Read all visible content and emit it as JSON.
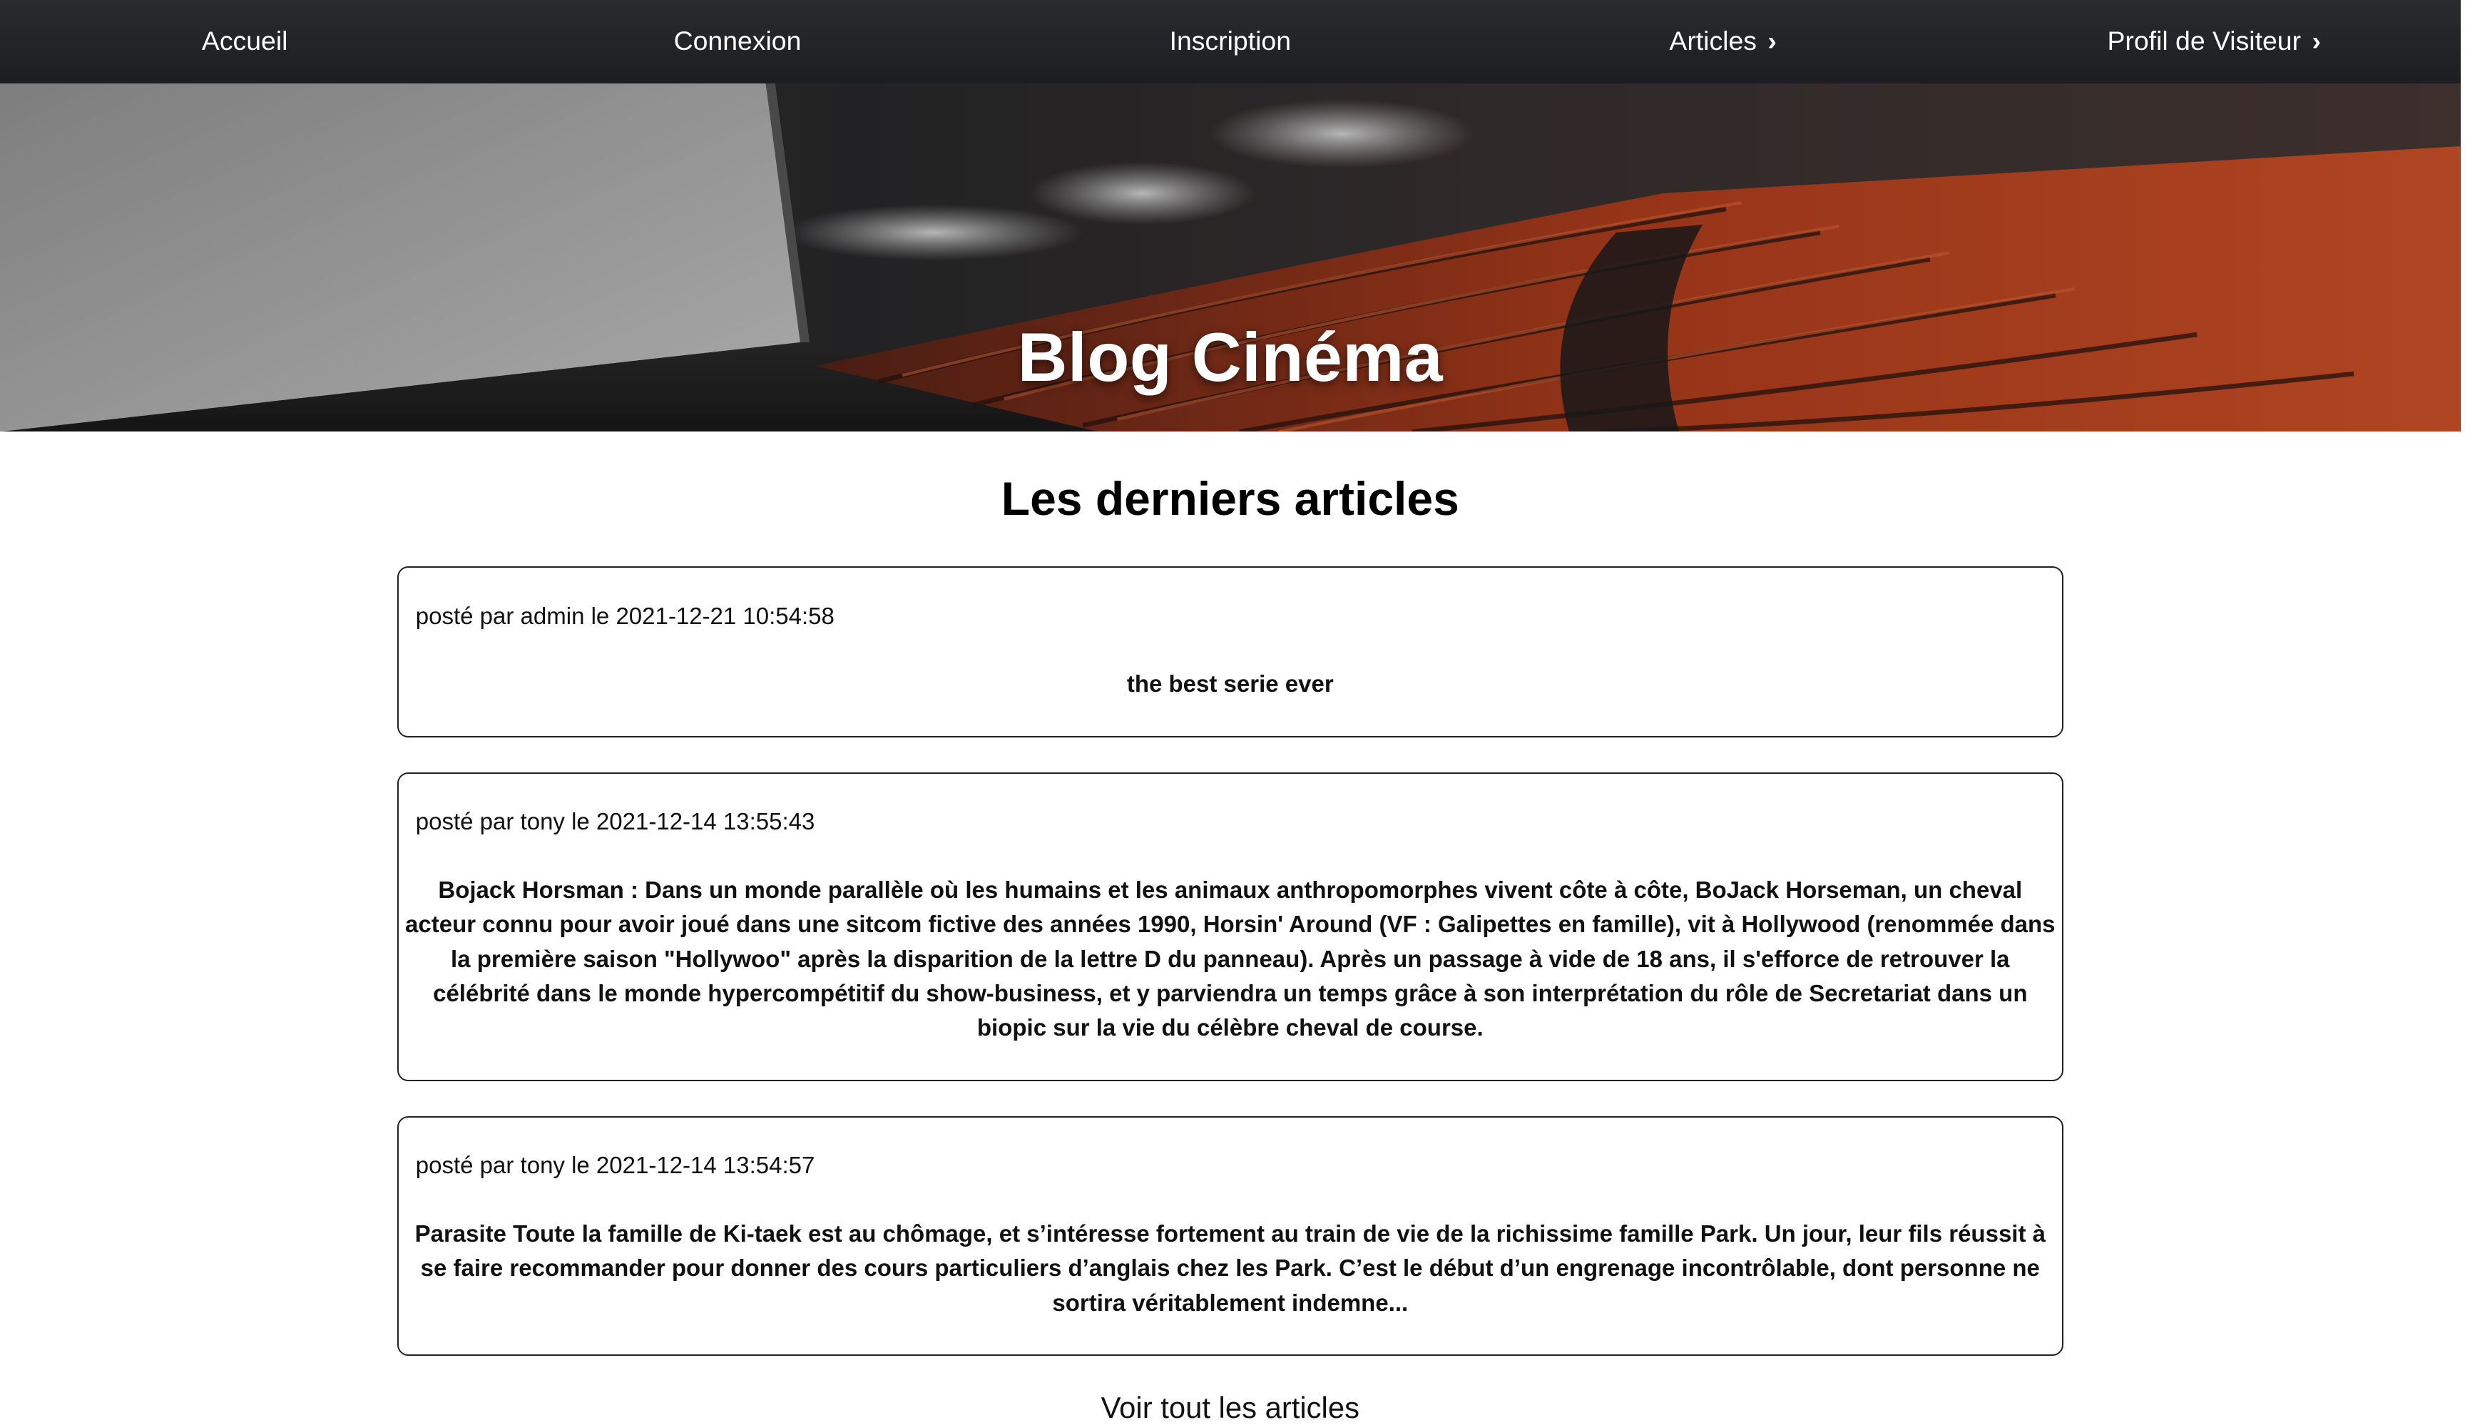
{
  "nav": {
    "items": [
      {
        "label": "Accueil",
        "has_chevron": false
      },
      {
        "label": "Connexion",
        "has_chevron": false
      },
      {
        "label": "Inscription",
        "has_chevron": false
      },
      {
        "label": "Articles",
        "has_chevron": true,
        "chevron": "›"
      },
      {
        "label": "Profil de Visiteur",
        "has_chevron": true,
        "chevron": "›"
      }
    ],
    "background": "#1f2023"
  },
  "hero": {
    "title": "Blog Cinéma",
    "image_subject": "cinema-hall-with-red-seats"
  },
  "main": {
    "section_title": "Les derniers articles",
    "articles": [
      {
        "meta": "posté par admin le 2021-12-21 10:54:58",
        "body": "the best serie ever"
      },
      {
        "meta": "posté par tony le 2021-12-14 13:55:43",
        "body": "Bojack Horsman : Dans un monde parallèle où les humains et les animaux anthropomorphes vivent côte à côte, BoJack Horseman, un cheval acteur connu pour avoir joué dans une sitcom fictive des années 1990, Horsin' Around (VF : Galipettes en famille), vit à Hollywood (renommée dans la première saison \"Hollywoo\" après la disparition de la lettre D du panneau). Après un passage à vide de 18 ans, il s'efforce de retrouver la célébrité dans le monde hypercompétitif du show-business, et y parviendra un temps grâce à son interprétation du rôle de Secretariat dans un biopic sur la vie du célèbre cheval de course."
      },
      {
        "meta": "posté par tony le 2021-12-14 13:54:57",
        "body": "Parasite Toute la famille de Ki-taek est au chômage, et s’intéresse fortement au train de vie de la richissime famille Park. Un jour, leur fils réussit à se faire recommander pour donner des cours particuliers d’anglais chez les Park. C’est le début d’un engrenage incontrôlable, dont personne ne sortira véritablement indemne..."
      }
    ],
    "see_all": "Voir tout les articles"
  }
}
